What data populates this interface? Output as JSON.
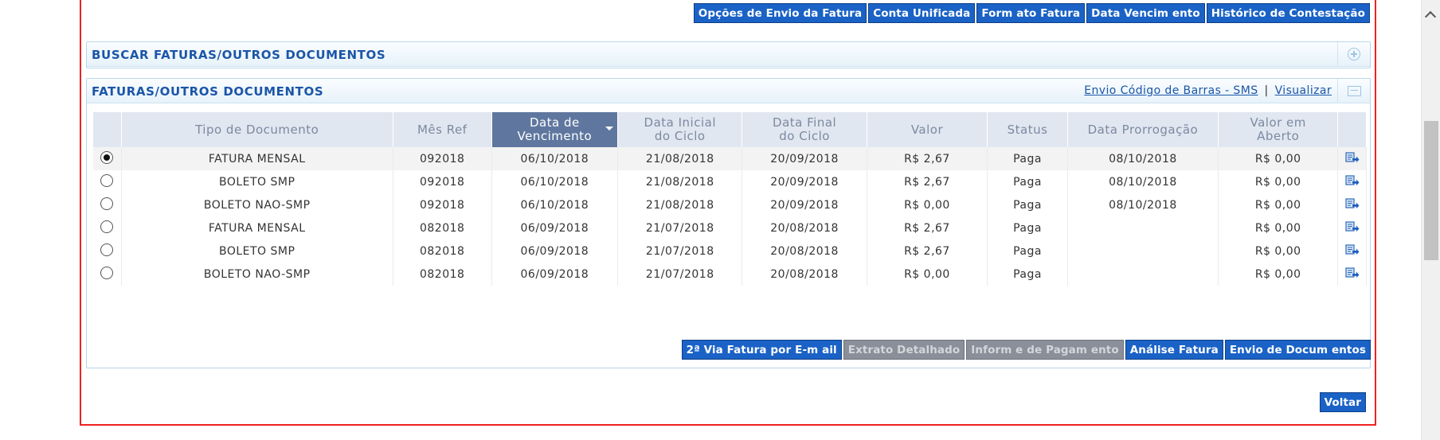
{
  "top_actions": [
    "Opções de Envio da Fatura",
    "Conta Unificada",
    "Form ato Fatura",
    "Data Vencim ento",
    "Histórico de Contestação"
  ],
  "search_panel": {
    "title": "BUSCAR FATURAS/OUTROS DOCUMENTOS"
  },
  "invoices_panel": {
    "title": "FATURAS/OUTROS DOCUMENTOS",
    "link_sms": "Envio Código de Barras - SMS",
    "link_separator": "|",
    "link_view": "Visualizar"
  },
  "table": {
    "headers": {
      "tipo": "Tipo de Documento",
      "mes_ref": "Mês Ref",
      "vencimento_l1": "Data de",
      "vencimento_l2": "Vencimento",
      "inicial_l1": "Data Inicial",
      "inicial_l2": "do Ciclo",
      "final_l1": "Data Final",
      "final_l2": "do Ciclo",
      "valor": "Valor",
      "status": "Status",
      "prorrogacao": "Data Prorrogação",
      "aberto_l1": "Valor em",
      "aberto_l2": "Aberto"
    },
    "rows": [
      {
        "tipo": "FATURA MENSAL",
        "mes_ref": "092018",
        "vencimento": "06/10/2018",
        "inicial": "21/08/2018",
        "final": "20/09/2018",
        "valor": "R$ 2,67",
        "status": "Paga",
        "prorrogacao": "08/10/2018",
        "aberto": "R$ 0,00"
      },
      {
        "tipo": "BOLETO SMP",
        "mes_ref": "092018",
        "vencimento": "06/10/2018",
        "inicial": "21/08/2018",
        "final": "20/09/2018",
        "valor": "R$ 2,67",
        "status": "Paga",
        "prorrogacao": "08/10/2018",
        "aberto": "R$ 0,00"
      },
      {
        "tipo": "BOLETO NAO-SMP",
        "mes_ref": "092018",
        "vencimento": "06/10/2018",
        "inicial": "21/08/2018",
        "final": "20/09/2018",
        "valor": "R$ 0,00",
        "status": "Paga",
        "prorrogacao": "08/10/2018",
        "aberto": "R$ 0,00"
      },
      {
        "tipo": "FATURA MENSAL",
        "mes_ref": "082018",
        "vencimento": "06/09/2018",
        "inicial": "21/07/2018",
        "final": "20/08/2018",
        "valor": "R$ 2,67",
        "status": "Paga",
        "prorrogacao": "",
        "aberto": "R$ 0,00"
      },
      {
        "tipo": "BOLETO SMP",
        "mes_ref": "082018",
        "vencimento": "06/09/2018",
        "inicial": "21/07/2018",
        "final": "20/08/2018",
        "valor": "R$ 2,67",
        "status": "Paga",
        "prorrogacao": "",
        "aberto": "R$ 0,00"
      },
      {
        "tipo": "BOLETO NAO-SMP",
        "mes_ref": "082018",
        "vencimento": "06/09/2018",
        "inicial": "21/07/2018",
        "final": "20/08/2018",
        "valor": "R$ 0,00",
        "status": "Paga",
        "prorrogacao": "",
        "aberto": "R$ 0,00"
      }
    ]
  },
  "bottom_actions": {
    "segunda_via": "2ª Via Fatura por E-m ail",
    "extrato": "Extrato Detalhado",
    "informe": "Inform e de Pagam ento",
    "analise": "Análise Fatura",
    "envio": "Envio de Docum entos"
  },
  "voltar": "Voltar",
  "colors": {
    "button_blue": "#1a62c6",
    "header_blue": "#1b56a8",
    "sorted_header": "#5f779f",
    "frame_red": "#e22"
  }
}
